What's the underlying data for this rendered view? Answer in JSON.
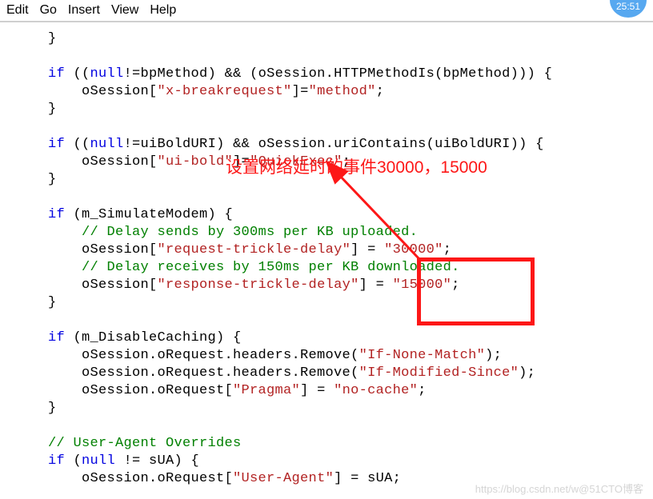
{
  "menubar": {
    "items": [
      "Edit",
      "Go",
      "Insert",
      "View",
      "Help"
    ]
  },
  "timer": "25:51",
  "code": {
    "l1_b": "}",
    "l2": "",
    "l3_a": "if",
    "l3_b": " ((",
    "l3_c": "null",
    "l3_d": "!=bpMethod) && (oSession.HTTPMethodIs(bpMethod))) {",
    "l4_a": "    oSession[",
    "l4_b": "\"x-breakrequest\"",
    "l4_c": "]=",
    "l4_d": "\"method\"",
    "l4_e": ";",
    "l5_b": "}",
    "l6": "",
    "l7_a": "if",
    "l7_b": " ((",
    "l7_c": "null",
    "l7_d": "!=uiBoldURI) && oSession.uriContains(uiBoldURI)) {",
    "l8_a": "    oSession[",
    "l8_b": "\"ui-bold\"",
    "l8_c": "]=",
    "l8_d": "\"QuickExec\"",
    "l8_e": ";",
    "l9_b": "}",
    "l10": "",
    "l11_a": "if",
    "l11_b": " (m_SimulateModem) {",
    "l12": "    // Delay sends by 300ms per KB uploaded.",
    "l13_a": "    oSession[",
    "l13_b": "\"request-trickle-delay\"",
    "l13_c": "] = ",
    "l13_d": "\"30000\"",
    "l13_e": ";",
    "l14": "    // Delay receives by 150ms per KB downloaded.",
    "l15_a": "    oSession[",
    "l15_b": "\"response-trickle-delay\"",
    "l15_c": "] = ",
    "l15_d": "\"15000\"",
    "l15_e": ";",
    "l16_b": "}",
    "l17": "",
    "l18_a": "if",
    "l18_b": " (m_DisableCaching) {",
    "l19_a": "    oSession.oRequest.headers.Remove(",
    "l19_b": "\"If-None-Match\"",
    "l19_c": ");",
    "l20_a": "    oSession.oRequest.headers.Remove(",
    "l20_b": "\"If-Modified-Since\"",
    "l20_c": ");",
    "l21_a": "    oSession.oRequest[",
    "l21_b": "\"Pragma\"",
    "l21_c": "] = ",
    "l21_d": "\"no-cache\"",
    "l21_e": ";",
    "l22_b": "}",
    "l23": "",
    "l24": "// User-Agent Overrides",
    "l25_a": "if",
    "l25_b": " (",
    "l25_c": "null",
    "l25_d": " != sUA) {",
    "l26_a": "    oSession.oRequest[",
    "l26_b": "\"User-Agent\"",
    "l26_c": "] = sUA;"
  },
  "annotation": "设置网络延时的事件30000，15000",
  "watermark": "https://blog.csdn.net/w@51CTO博客"
}
